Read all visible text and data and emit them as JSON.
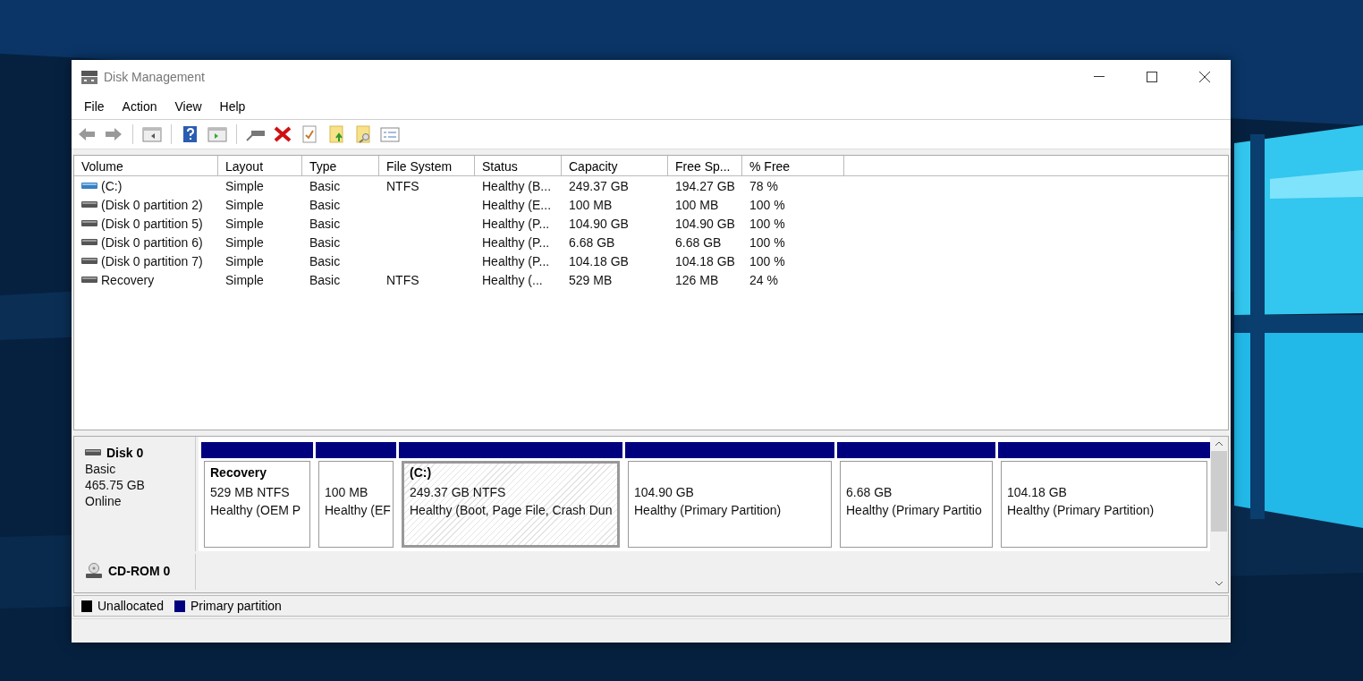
{
  "window": {
    "title": "Disk Management"
  },
  "menu": [
    "File",
    "Action",
    "View",
    "Help"
  ],
  "volume_table": {
    "columns": [
      "Volume",
      "Layout",
      "Type",
      "File System",
      "Status",
      "Capacity",
      "Free Sp...",
      "% Free"
    ],
    "rows": [
      {
        "cells": [
          "(C:)",
          "Simple",
          "Basic",
          "NTFS",
          "Healthy (B...",
          "249.37 GB",
          "194.27 GB",
          "78 %"
        ],
        "kind": "system"
      },
      {
        "cells": [
          "(Disk 0 partition 2)",
          "Simple",
          "Basic",
          "",
          "Healthy (E...",
          "100 MB",
          "100 MB",
          "100 %"
        ],
        "kind": "plain"
      },
      {
        "cells": [
          "(Disk 0 partition 5)",
          "Simple",
          "Basic",
          "",
          "Healthy (P...",
          "104.90 GB",
          "104.90 GB",
          "100 %"
        ],
        "kind": "plain"
      },
      {
        "cells": [
          "(Disk 0 partition 6)",
          "Simple",
          "Basic",
          "",
          "Healthy (P...",
          "6.68 GB",
          "6.68 GB",
          "100 %"
        ],
        "kind": "plain"
      },
      {
        "cells": [
          "(Disk 0 partition 7)",
          "Simple",
          "Basic",
          "",
          "Healthy (P...",
          "104.18 GB",
          "104.18 GB",
          "100 %"
        ],
        "kind": "plain"
      },
      {
        "cells": [
          "Recovery",
          "Simple",
          "Basic",
          "NTFS",
          "Healthy (...",
          "529 MB",
          "126 MB",
          "24 %"
        ],
        "kind": "plain"
      }
    ]
  },
  "disks": [
    {
      "kind": "disk",
      "name": "Disk 0",
      "details": [
        "Basic",
        "465.75 GB",
        "Online"
      ],
      "partitions": [
        {
          "name": "Recovery",
          "size": "529 MB NTFS",
          "status": "Healthy (OEM P",
          "selected": false
        },
        {
          "size": "100 MB",
          "status": "Healthy (EF",
          "selected": false
        },
        {
          "name": "(C:)",
          "size": "249.37 GB NTFS",
          "status": "Healthy (Boot, Page File, Crash Dun",
          "selected": true
        },
        {
          "size": "104.90 GB",
          "status": "Healthy (Primary Partition)",
          "selected": false
        },
        {
          "size": "6.68 GB",
          "status": "Healthy (Primary Partitio",
          "selected": false
        },
        {
          "size": "104.18 GB",
          "status": "Healthy (Primary Partition)",
          "selected": false
        }
      ]
    },
    {
      "kind": "cdrom",
      "name": "CD-ROM 0"
    }
  ],
  "legend": [
    {
      "label": "Unallocated",
      "color": "#000000"
    },
    {
      "label": "Primary partition",
      "color": "#00007f"
    }
  ]
}
